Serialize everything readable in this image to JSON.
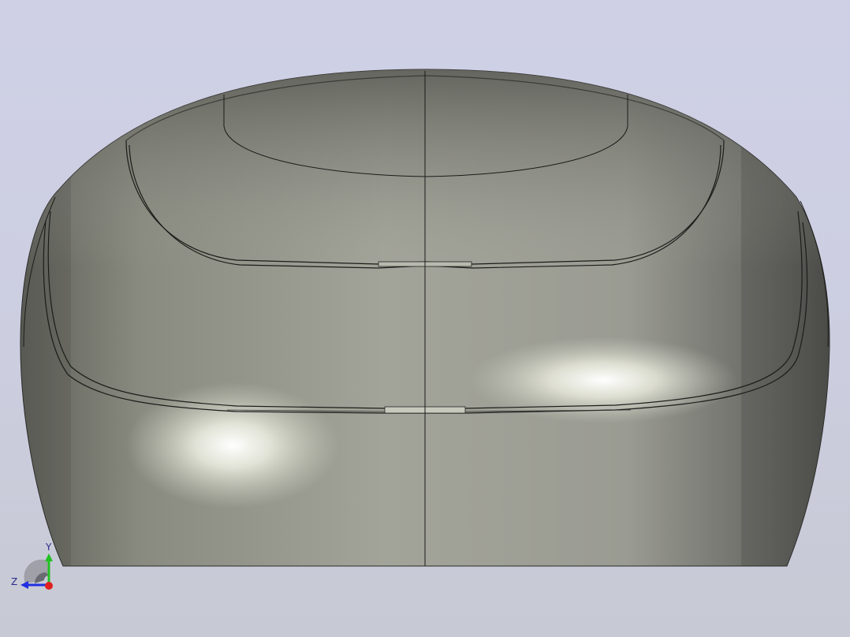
{
  "viewport": {
    "background_top": "#cfd0e6",
    "background_bottom": "#c7c9d4"
  },
  "model": {
    "body_color": "#9c9d92",
    "edge_color": "#1a1a1a",
    "highlight_color": "#ffffff"
  },
  "triad": {
    "x_color": "#e02020",
    "y_color": "#22c022",
    "z_color": "#2030e0",
    "labels": {
      "y": "Y",
      "z": "Z"
    }
  }
}
